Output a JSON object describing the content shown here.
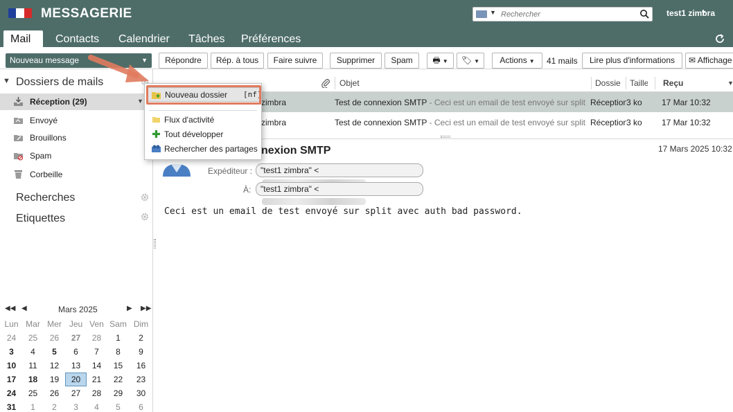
{
  "header": {
    "app_title": "MESSAGERIE",
    "search_placeholder": "Rechercher",
    "user_name": "test1 zimbra"
  },
  "tabs": [
    "Mail",
    "Contacts",
    "Calendrier",
    "Tâches",
    "Préférences"
  ],
  "toolbar": {
    "new_message": "Nouveau message",
    "reply": "Répondre",
    "reply_all": "Rép. à tous",
    "forward": "Faire suivre",
    "delete": "Supprimer",
    "spam": "Spam",
    "actions": "Actions",
    "mail_count": "41 mails",
    "read_more": "Lire plus d'informations",
    "display": "Affichage"
  },
  "sidebar": {
    "mail_folders_title": "Dossiers de mails",
    "folders": [
      {
        "label": "Réception (29)",
        "icon": "inbox-icon"
      },
      {
        "label": "Envoyé",
        "icon": "sent-icon"
      },
      {
        "label": "Brouillons",
        "icon": "drafts-icon"
      },
      {
        "label": "Spam",
        "icon": "spam-icon"
      },
      {
        "label": "Corbeille",
        "icon": "trash-icon"
      }
    ],
    "searches_title": "Recherches",
    "tags_title": "Etiquettes"
  },
  "calendar": {
    "month": "Mars 2025",
    "days_of_week": [
      "Lun",
      "Mar",
      "Mer",
      "Jeu",
      "Ven",
      "Sam",
      "Dim"
    ],
    "weeks": [
      [
        "24",
        "25",
        "26",
        "27",
        "28",
        "1",
        "2"
      ],
      [
        "3",
        "4",
        "5",
        "6",
        "7",
        "8",
        "9"
      ],
      [
        "10",
        "11",
        "12",
        "13",
        "14",
        "15",
        "16"
      ],
      [
        "17",
        "18",
        "19",
        "20",
        "21",
        "22",
        "23"
      ],
      [
        "24",
        "25",
        "26",
        "27",
        "28",
        "29",
        "30"
      ],
      [
        "31",
        "1",
        "2",
        "3",
        "4",
        "5",
        "6"
      ]
    ],
    "today": "20"
  },
  "mail_list": {
    "columns": {
      "subject": "Objet",
      "folder": "Dossie",
      "size": "Taille",
      "received": "Reçu"
    },
    "rows": [
      {
        "from": "zimbra",
        "subject": "Test de connexion SMTP",
        "fragment": " - Ceci est un email de test envoyé sur split av",
        "folder": "Réception",
        "size": "3 ko",
        "received": "17 Mar 10:32"
      },
      {
        "from": "zimbra",
        "subject": "Test de connexion SMTP",
        "fragment": " - Ceci est un email de test envoyé sur split av",
        "folder": "Réception",
        "size": "3 ko",
        "received": "17 Mar 10:32"
      }
    ]
  },
  "reading_pane": {
    "subject": "nexion SMTP",
    "date": "17 Mars 2025 10:32",
    "sender_label": "Expéditeur :",
    "sender_value": "\"test1 zimbra\" <",
    "to_label": "À:",
    "to_value": "\"test1 zimbra\" <",
    "body": "Ceci est un email de test envoyé sur split avec auth bad password."
  },
  "context_menu": {
    "items": [
      {
        "label": "Nouveau dossier",
        "shortcut": "[nf]",
        "icon": "new-folder-icon"
      },
      {
        "label": "Flux d'activité",
        "icon": "activity-folder-icon"
      },
      {
        "label": "Tout développer",
        "icon": "expand-all-icon"
      },
      {
        "label": "Rechercher des partages",
        "icon": "find-shares-icon"
      }
    ]
  },
  "colors": {
    "header_bg": "#4e6d69",
    "selected_row": "#c9d1cf",
    "annotation": "#e07b5f",
    "today_bg": "#b9d6ec"
  }
}
